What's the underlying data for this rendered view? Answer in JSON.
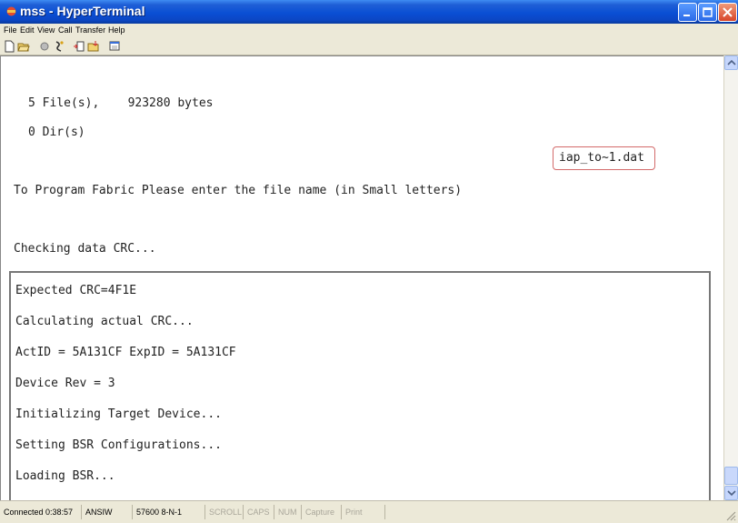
{
  "window": {
    "title": "mss - HyperTerminal"
  },
  "menu": {
    "items": [
      "File",
      "Edit",
      "View",
      "Call",
      "Transfer",
      "Help"
    ]
  },
  "toolbar": {
    "icons": [
      "new-icon",
      "open-icon",
      "connect-icon",
      "disconnect-icon",
      "send-icon",
      "receive-icon",
      "properties-icon"
    ]
  },
  "terminal": {
    "lines_top": [
      "5 File(s),    923280 bytes",
      "0 Dir(s)",
      "To Program Fabric Please enter the file name (in Small letters)",
      "Checking data CRC..."
    ],
    "typed_filename": "iap_to~1.dat",
    "lines_inset": [
      "Expected CRC=4F1E",
      "Calculating actual CRC...",
      "ActID = 5A131CF ExpID = 5A131CF",
      "Device Rev = 3",
      "Initializing Target Device...",
      "Setting BSR Configurations...",
      "Loading BSR..."
    ]
  },
  "status": {
    "connected": "Connected 0:38:57",
    "emulation": "ANSIW",
    "settings": "57600 8-N-1",
    "scroll": "SCROLL",
    "caps": "CAPS",
    "num": "NUM",
    "capture": "Capture",
    "print_echo": "Print echo"
  }
}
